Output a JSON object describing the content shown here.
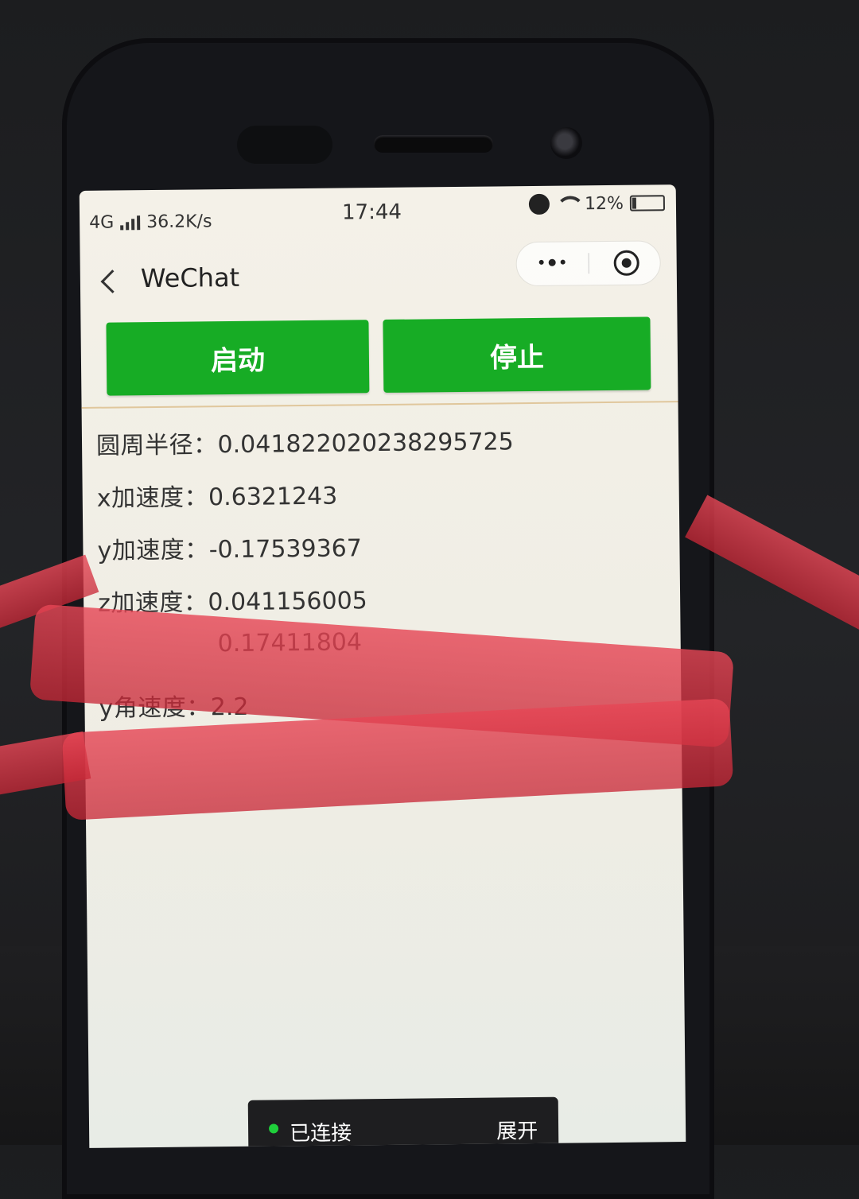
{
  "status_bar": {
    "network": "4G",
    "speed": "36.2K/s",
    "time": "17:44",
    "battery": "12%",
    "battery_level": 0.12
  },
  "nav": {
    "title": "WeChat"
  },
  "buttons": {
    "start_label": "启动",
    "stop_label": "停止",
    "accent_color": "#17ac25"
  },
  "readings": [
    {
      "label": "圆周半径：",
      "value": "0.041822020238295725"
    },
    {
      "label": "x加速度：",
      "value": "0.6321243"
    },
    {
      "label": "y加速度：",
      "value": "-0.17539367"
    },
    {
      "label": "z加速度：",
      "value": "0.041156005"
    },
    {
      "label": "",
      "value": "0.17411804"
    },
    {
      "label": "y角速度：",
      "value": "2.2"
    }
  ],
  "floating_bar": {
    "status": "已连接",
    "expand_label": "展开",
    "status_color": "#1fcf3b"
  }
}
